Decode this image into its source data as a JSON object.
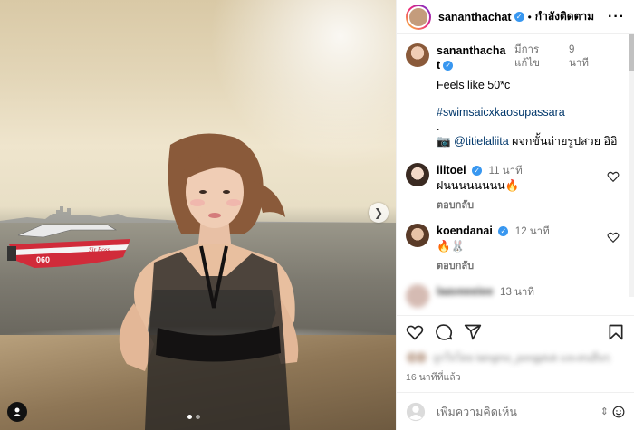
{
  "post": {
    "username": "sananthachat",
    "verified": true,
    "follow_label": "กำลังติดตาม",
    "separator": "•",
    "more": "···"
  },
  "caption": {
    "username": "sananthachat",
    "edited_label": "มีการแก้ไข",
    "time_label": "9 นาที",
    "line1": "Feels like 50*c",
    "hashtag": "#swimsaicxkaosupassara",
    "dot_line": ".",
    "credit_mention": "@titielaliita",
    "credit_text": " ผจกขั้นถ่ายรูปสวย อิอิ",
    "camera_icon": "📷"
  },
  "comments": [
    {
      "username": "iiitoei",
      "verified": true,
      "time": "11 นาที",
      "text": "ฝนนนนนนนน🔥",
      "reply_label": "ตอบกลับ"
    },
    {
      "username": "koendanai",
      "verified": true,
      "time": "12 นาที",
      "text": "🔥🐰",
      "reply_label": "ตอบกลับ"
    },
    {
      "username": "laaveeeiee",
      "verified": false,
      "time": "13 นาที",
      "text": "",
      "reply_label": ""
    }
  ],
  "actions": {
    "like_icon": "heart-icon",
    "comment_icon": "comment-icon",
    "share_icon": "share-icon",
    "save_icon": "bookmark-icon"
  },
  "likes": {
    "text": "ถูกใจโดย laingmo_pongptuk และคนอื่นๆ"
  },
  "post_time": "16 นาทีที่แล้ว",
  "add_comment": {
    "placeholder": "เพิ่มความคิดเห็น"
  },
  "carousel": {
    "count": 2,
    "active_index": 0
  },
  "colors": {
    "verified": "#3897f0",
    "link": "#00376b",
    "muted": "#737373"
  }
}
